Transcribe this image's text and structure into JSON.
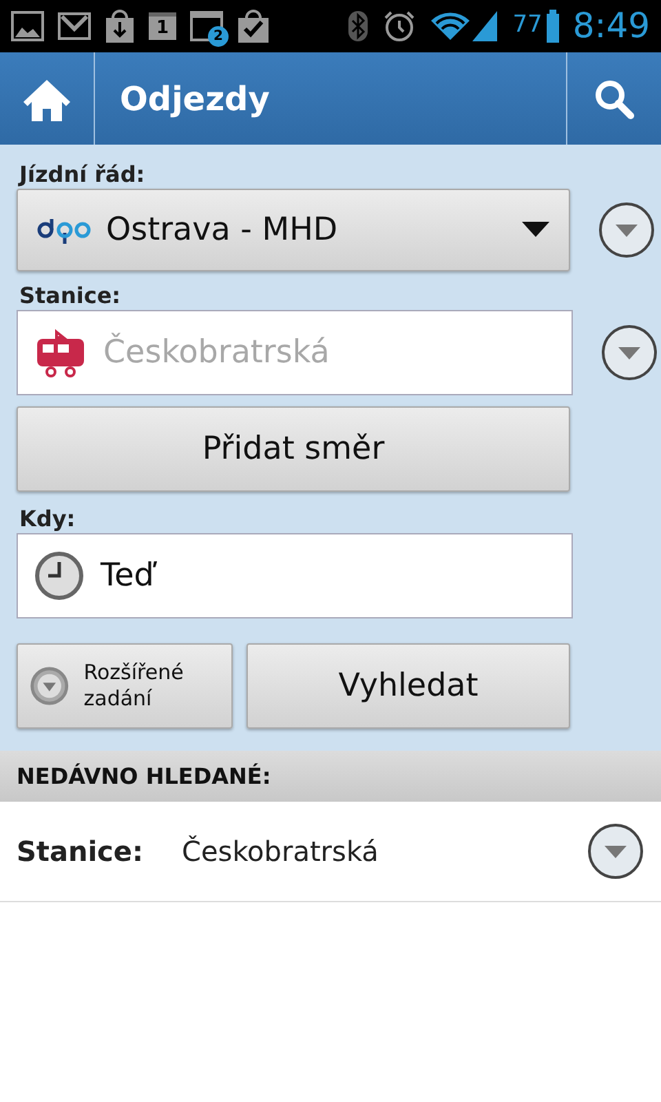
{
  "status_bar": {
    "calendar_day": "1",
    "notification_count": "2",
    "battery": "77",
    "time": "8:49"
  },
  "header": {
    "title": "Odjezdy"
  },
  "form": {
    "timetable_label": "Jízdní řád:",
    "timetable_value": "Ostrava - MHD",
    "station_label": "Stanice:",
    "station_placeholder": "Českobratrská",
    "add_direction": "Přidat směr",
    "when_label": "Kdy:",
    "when_value": "Teď",
    "advanced": "Rozšířené zadání",
    "search": "Vyhledat"
  },
  "recent": {
    "title": "NEDÁVNO HLEDANÉ:",
    "items": [
      {
        "label": "Stanice:",
        "value": "Českobratrská"
      }
    ]
  }
}
